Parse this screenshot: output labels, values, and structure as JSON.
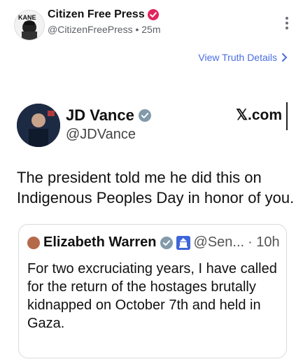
{
  "post": {
    "author_name": "Citizen Free Press",
    "handle_time": "@CitizenFreePress • 25m",
    "view_details_label": "View Truth Details",
    "avatar_text": "KANE"
  },
  "tweet": {
    "name": "JD Vance",
    "handle": "@JDVance",
    "source": "𝕏.com",
    "text": "The president told me he did this on Indigenous Peoples Day in honor of you."
  },
  "quote": {
    "name": "Elizabeth Warren",
    "handle": "@Sen...",
    "time": "· 10h",
    "text": "For two excruciating years, I have called for the return of the hostages brutally kidnapped on October 7th and held in Gaza."
  },
  "colors": {
    "accent": "#4a6ee0",
    "verified": "#e0245e",
    "tweet_verified": "#829aab"
  }
}
